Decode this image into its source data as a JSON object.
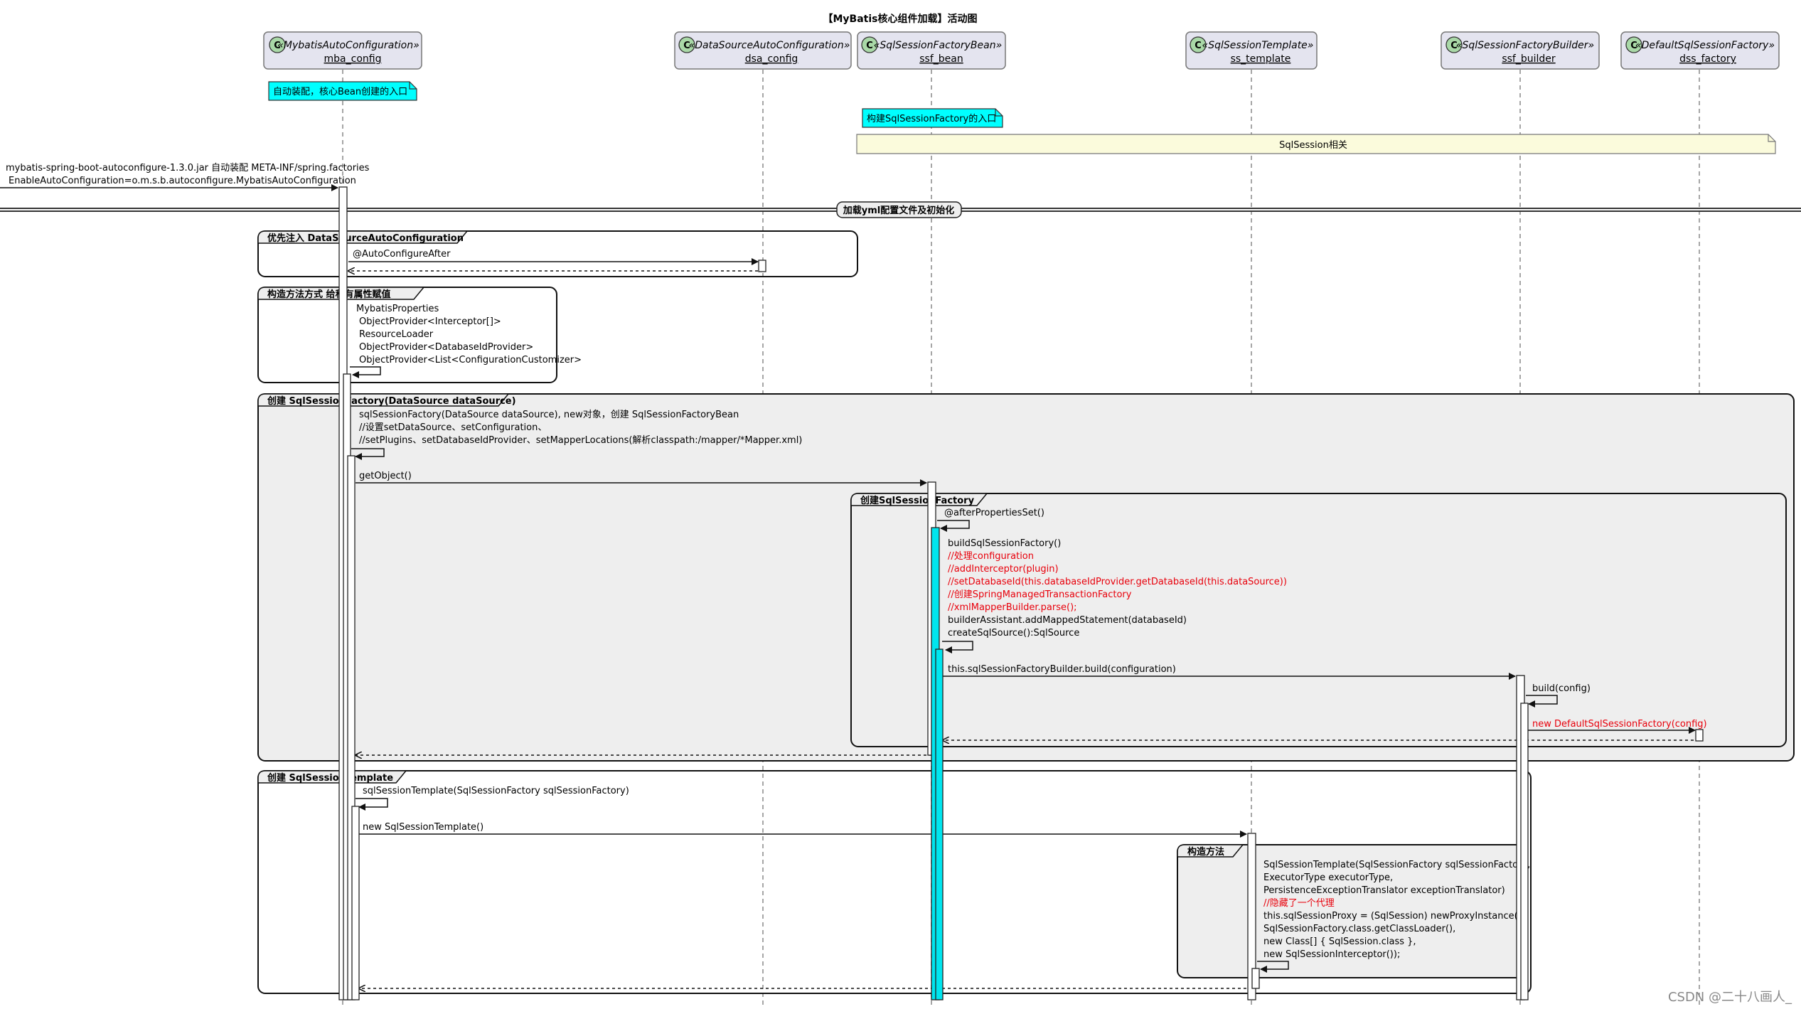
{
  "title": "【MyBatis核心组件加载】活动图",
  "participants": [
    {
      "stereotype": "«MybatisAutoConfiguration»",
      "name": "mba_config"
    },
    {
      "stereotype": "«DataSourceAutoConfiguration»",
      "name": "dsa_config"
    },
    {
      "stereotype": "«SqlSessionFactoryBean»",
      "name": "ssf_bean"
    },
    {
      "stereotype": "«SqlSessionTemplate»",
      "name": "ss_template"
    },
    {
      "stereotype": "«SqlSessionFactoryBuilder»",
      "name": "ssf_builder"
    },
    {
      "stereotype": "«DefaultSqlSessionFactory»",
      "name": "dss_factory"
    }
  ],
  "class_badge": "C",
  "notes": {
    "auto_config": "自动装配，核心Bean创建的入口",
    "ssf_entry": "构建SqlSessionFactory的入口",
    "sqlsession": "SqlSession相关"
  },
  "entry_message": {
    "lines": [
      "mybatis-spring-boot-autoconfigure-1.3.0.jar 自动装配 META-INF/spring.factories",
      "EnableAutoConfiguration=o.m.s.b.autoconfigure.MybatisAutoConfiguration"
    ]
  },
  "separator": "加载yml配置文件及初始化",
  "groups": {
    "g1": {
      "label": "优先注入 DataSourceAutoConfiguration",
      "msg": "@AutoConfigureAfter"
    },
    "g2": {
      "label": "构造方法方式 给私有属性赋值",
      "lines": [
        "MybatisProperties",
        "ObjectProvider<Interceptor[]>",
        "ResourceLoader",
        "ObjectProvider<DatabaseIdProvider>",
        "ObjectProvider<List<ConfigurationCustomizer>"
      ]
    },
    "g3": {
      "label": "创建 SqlSessionFactory(DataSource dataSource)",
      "lines": [
        "sqlSessionFactory(DataSource dataSource), new对象，创建 SqlSessionFactoryBean",
        "//设置setDataSource、setConfiguration、",
        "//setPlugins、setDatabaseIdProvider、setMapperLocations(解析classpath:/mapper/*Mapper.xml)"
      ],
      "get_object": "getObject()"
    },
    "g4": {
      "label": "创建SqlSessionFactory",
      "after_props": "@afterPropertiesSet()",
      "build_lines": [
        {
          "text": "buildSqlSessionFactory()",
          "color": "#000000"
        },
        {
          "text": "//处理configuration",
          "color": "#e8000b"
        },
        {
          "text": "//addInterceptor(plugin)",
          "color": "#e8000b"
        },
        {
          "text": "//setDatabaseId(this.databaseIdProvider.getDatabaseId(this.dataSource))",
          "color": "#e8000b"
        },
        {
          "text": "//创建SpringManagedTransactionFactory",
          "color": "#e8000b"
        },
        {
          "text": "//xmlMapperBuilder.parse();",
          "color": "#e8000b"
        },
        {
          "text": "builderAssistant.addMappedStatement(databaseId)",
          "color": "#000000"
        },
        {
          "text": "createSqlSource():SqlSource",
          "color": "#000000"
        }
      ],
      "builder_build": "this.sqlSessionFactoryBuilder.build(configuration)",
      "build_config": "build(config)",
      "new_default": "new DefaultSqlSessionFactory(config)"
    },
    "g5": {
      "label": "创建 SqlSessionTemplate",
      "ctor": "sqlSessionTemplate(SqlSessionFactory sqlSessionFactory)",
      "new_template": "new SqlSessionTemplate()"
    },
    "g6": {
      "label": "构造方法",
      "lines": [
        {
          "text": "SqlSessionTemplate(SqlSessionFactory sqlSessionFactory,",
          "color": "#000000"
        },
        {
          "text": "ExecutorType executorType,",
          "color": "#000000"
        },
        {
          "text": "PersistenceExceptionTranslator exceptionTranslator)",
          "color": "#000000"
        },
        {
          "text": "//隐藏了一个代理",
          "color": "#e8000b"
        },
        {
          "text": "this.sqlSessionProxy = (SqlSession) newProxyInstance(",
          "color": "#000000"
        },
        {
          "text": "SqlSessionFactory.class.getClassLoader(),",
          "color": "#000000"
        },
        {
          "text": "new Class[] { SqlSession.class },",
          "color": "#000000"
        },
        {
          "text": "new SqlSessionInterceptor());",
          "color": "#000000"
        }
      ]
    }
  },
  "watermark": "CSDN @二十八画人_",
  "colors": {
    "highlight_text": "#e8000b",
    "note_cyan": "#00ffff",
    "activation_cyan": "#00e5ee",
    "note_yellow": "#fbfbdc",
    "frame_fill": "#eeeeee",
    "participant_fill": "#e4e4ef",
    "badge_fill": "#a9d8a7"
  }
}
